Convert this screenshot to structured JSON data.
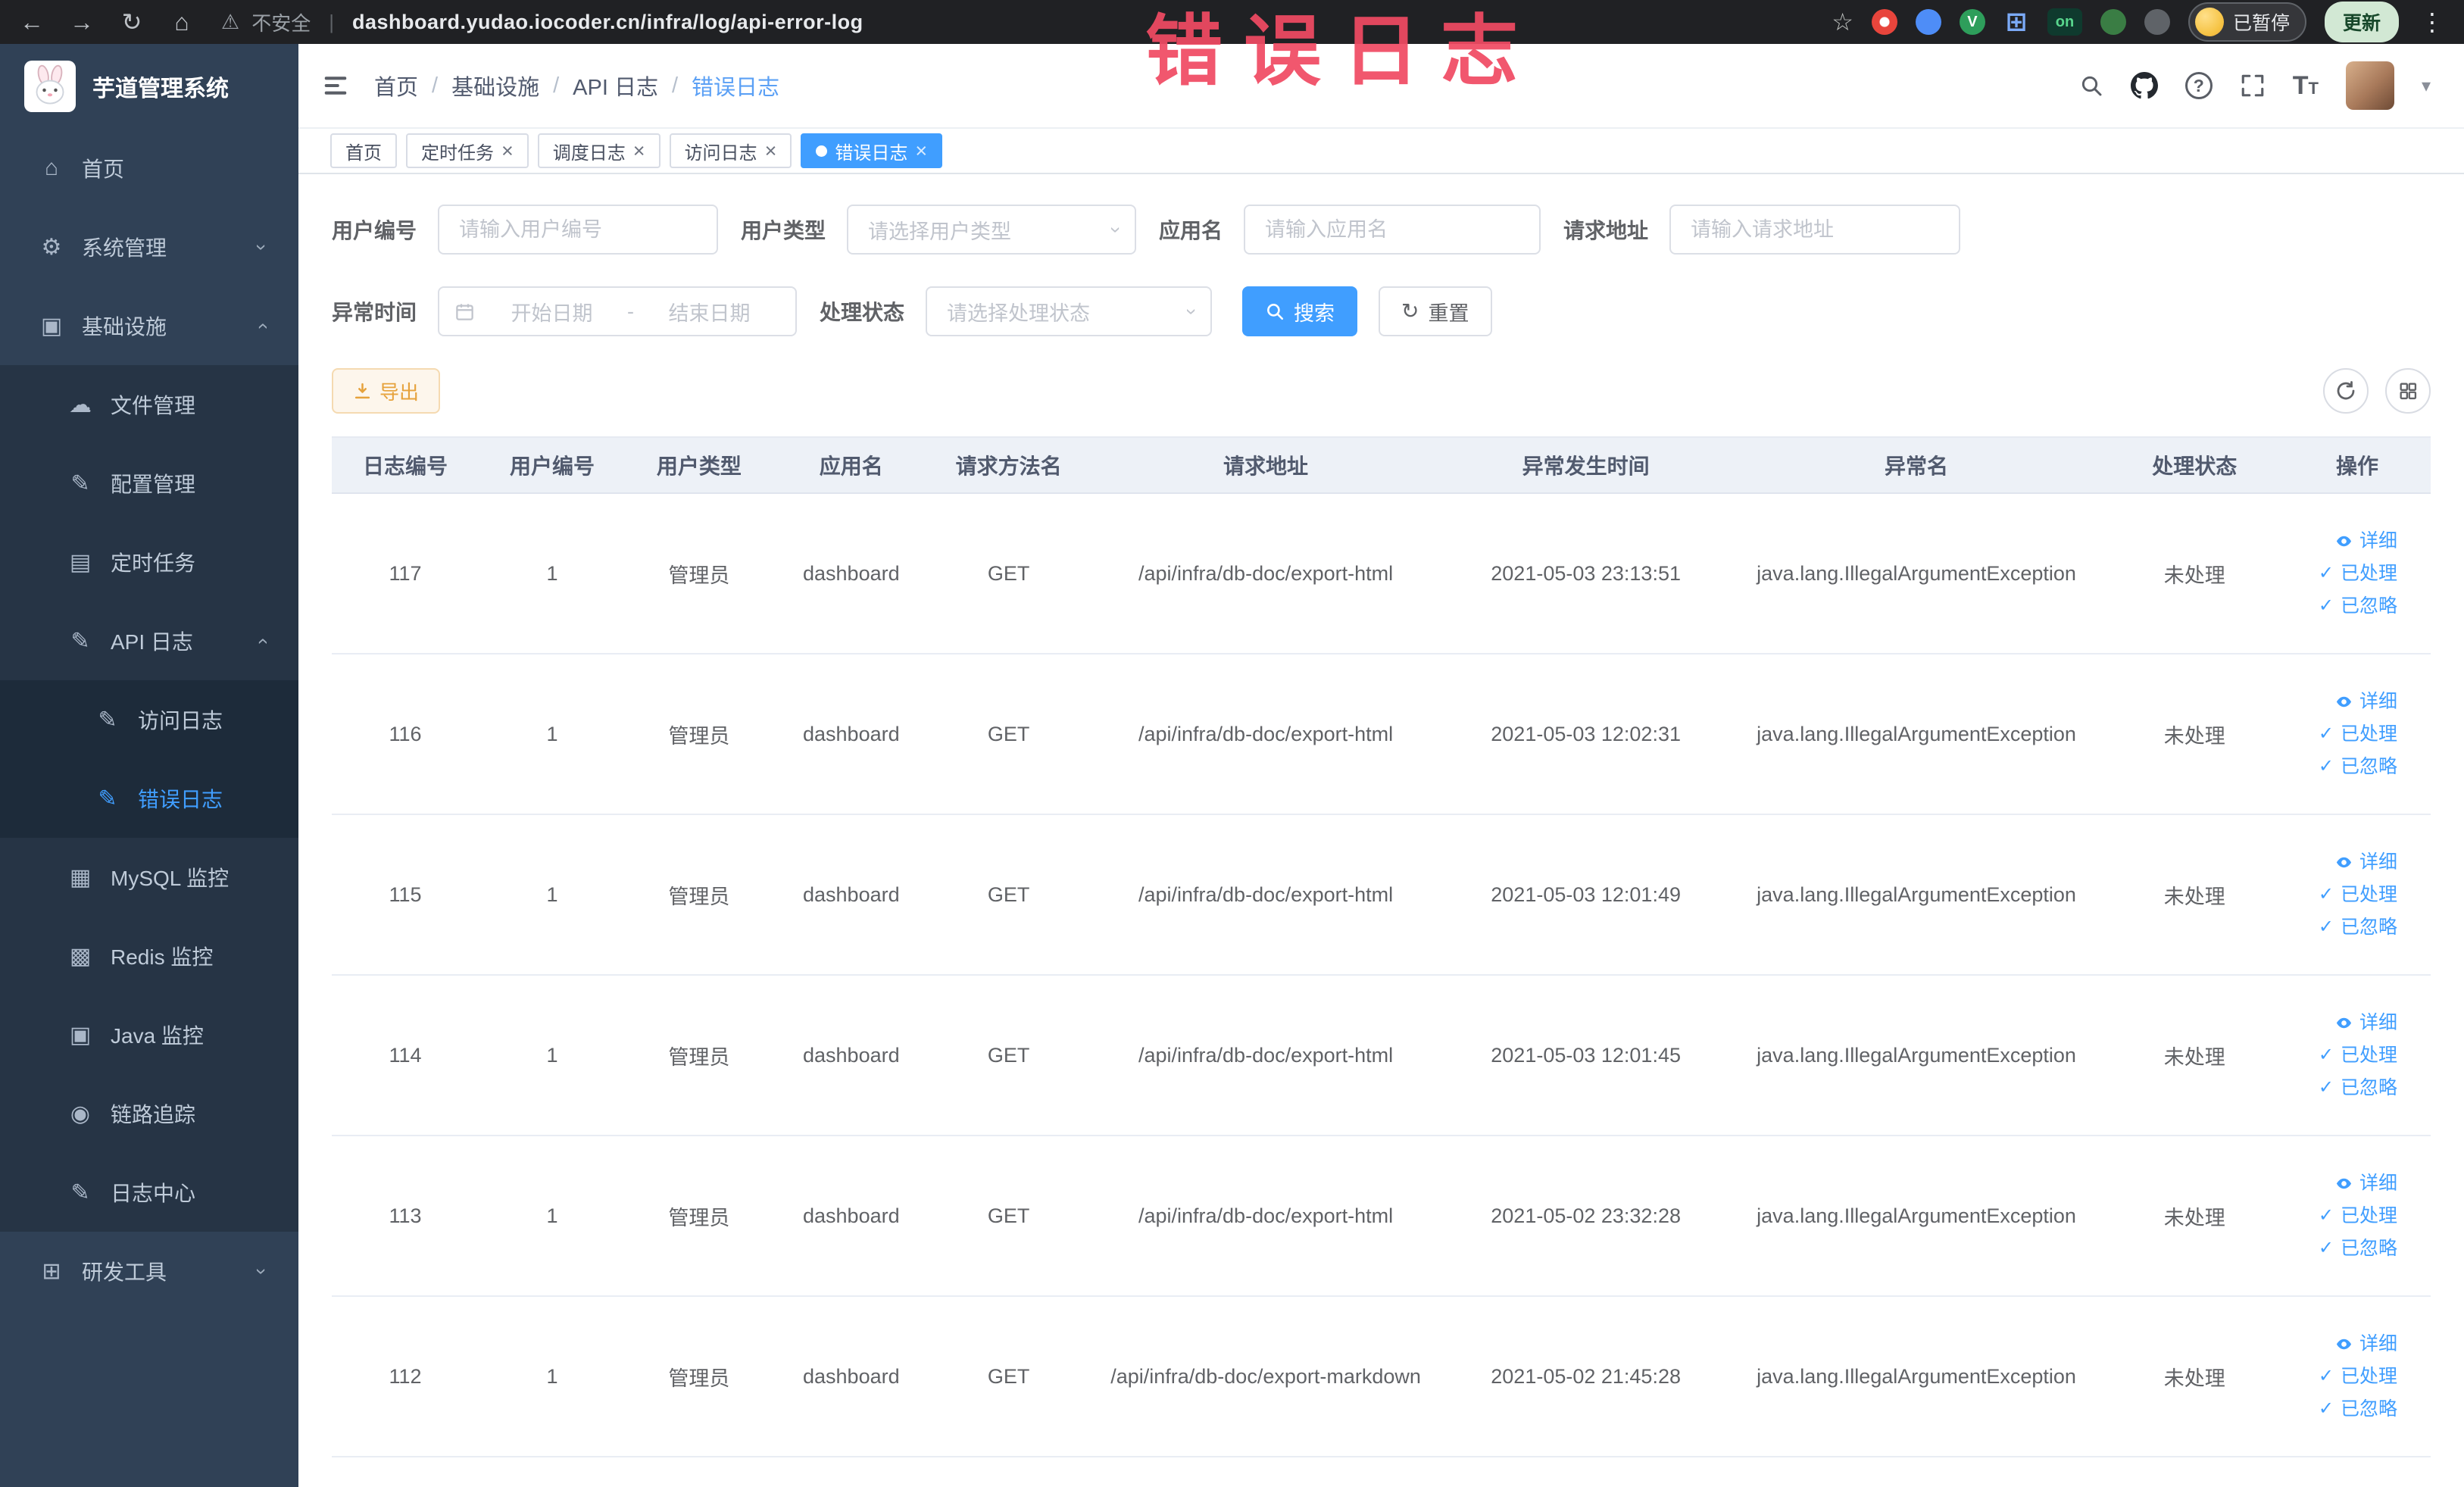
{
  "browser": {
    "security_label": "不安全",
    "url": "dashboard.yudao.iocoder.cn/infra/log/api-error-log",
    "extension_badge": "on",
    "profile_badge": "已暂停",
    "update_button": "更新"
  },
  "annotation": {
    "text": "错误日志"
  },
  "sidebar": {
    "logo_title": "芋道管理系统",
    "items": [
      {
        "key": "home",
        "label": "首页",
        "icon": "home",
        "level": 0
      },
      {
        "key": "system",
        "label": "系统管理",
        "icon": "gear",
        "level": 0,
        "chevron": "down"
      },
      {
        "key": "infra",
        "label": "基础设施",
        "icon": "monitor",
        "level": 0,
        "chevron": "up"
      },
      {
        "key": "file",
        "label": "文件管理",
        "icon": "cloud",
        "level": 1
      },
      {
        "key": "config",
        "label": "配置管理",
        "icon": "edit",
        "level": 1
      },
      {
        "key": "job",
        "label": "定时任务",
        "icon": "list",
        "level": 1
      },
      {
        "key": "api-log",
        "label": "API 日志",
        "icon": "edit",
        "level": 1,
        "chevron": "up"
      },
      {
        "key": "access-log",
        "label": "访问日志",
        "icon": "edit",
        "level": 2
      },
      {
        "key": "error-log",
        "label": "错误日志",
        "icon": "edit",
        "level": 2,
        "active": true
      },
      {
        "key": "mysql",
        "label": "MySQL 监控",
        "icon": "grid",
        "level": 1
      },
      {
        "key": "redis",
        "label": "Redis 监控",
        "icon": "layers",
        "level": 1
      },
      {
        "key": "java",
        "label": "Java 监控",
        "icon": "desktop",
        "level": 1
      },
      {
        "key": "trace",
        "label": "链路追踪",
        "icon": "eye",
        "level": 1
      },
      {
        "key": "log-center",
        "label": "日志中心",
        "icon": "edit",
        "level": 1
      },
      {
        "key": "devtools",
        "label": "研发工具",
        "icon": "toolbox",
        "level": 0,
        "chevron": "down"
      }
    ]
  },
  "header": {
    "breadcrumb": [
      "首页",
      "基础设施",
      "API 日志",
      "错误日志"
    ]
  },
  "tabs": [
    {
      "key": "home",
      "label": "首页",
      "closable": false,
      "active": false
    },
    {
      "key": "job",
      "label": "定时任务",
      "closable": true,
      "active": false
    },
    {
      "key": "job-log",
      "label": "调度日志",
      "closable": true,
      "active": false
    },
    {
      "key": "access-log",
      "label": "访问日志",
      "closable": true,
      "active": false
    },
    {
      "key": "error-log",
      "label": "错误日志",
      "closable": true,
      "active": true
    }
  ],
  "filters": {
    "user_id": {
      "label": "用户编号",
      "placeholder": "请输入用户编号"
    },
    "user_type": {
      "label": "用户类型",
      "placeholder": "请选择用户类型"
    },
    "app_name": {
      "label": "应用名",
      "placeholder": "请输入应用名"
    },
    "request_url": {
      "label": "请求地址",
      "placeholder": "请输入请求地址"
    },
    "exception_time": {
      "label": "异常时间",
      "start_placeholder": "开始日期",
      "separator": "-",
      "end_placeholder": "结束日期"
    },
    "process_status": {
      "label": "处理状态",
      "placeholder": "请选择处理状态"
    },
    "search_button": "搜索",
    "reset_button": "重置"
  },
  "toolbar": {
    "export_button": "导出"
  },
  "table": {
    "columns": [
      "日志编号",
      "用户编号",
      "用户类型",
      "应用名",
      "请求方法名",
      "请求地址",
      "异常发生时间",
      "异常名",
      "处理状态",
      "操作"
    ],
    "row_actions": [
      "详细",
      "已处理",
      "已忽略"
    ],
    "rows": [
      {
        "id": "117",
        "user_id": "1",
        "user_type": "管理员",
        "app_name": "dashboard",
        "method": "GET",
        "url": "/api/infra/db-doc/export-html",
        "time": "2021-05-03 23:13:51",
        "exception": "java.lang.IllegalArgumentException",
        "status": "未处理"
      },
      {
        "id": "116",
        "user_id": "1",
        "user_type": "管理员",
        "app_name": "dashboard",
        "method": "GET",
        "url": "/api/infra/db-doc/export-html",
        "time": "2021-05-03 12:02:31",
        "exception": "java.lang.IllegalArgumentException",
        "status": "未处理"
      },
      {
        "id": "115",
        "user_id": "1",
        "user_type": "管理员",
        "app_name": "dashboard",
        "method": "GET",
        "url": "/api/infra/db-doc/export-html",
        "time": "2021-05-03 12:01:49",
        "exception": "java.lang.IllegalArgumentException",
        "status": "未处理"
      },
      {
        "id": "114",
        "user_id": "1",
        "user_type": "管理员",
        "app_name": "dashboard",
        "method": "GET",
        "url": "/api/infra/db-doc/export-html",
        "time": "2021-05-03 12:01:45",
        "exception": "java.lang.IllegalArgumentException",
        "status": "未处理"
      },
      {
        "id": "113",
        "user_id": "1",
        "user_type": "管理员",
        "app_name": "dashboard",
        "method": "GET",
        "url": "/api/infra/db-doc/export-html",
        "time": "2021-05-02 23:32:28",
        "exception": "java.lang.IllegalArgumentException",
        "status": "未处理"
      },
      {
        "id": "112",
        "user_id": "1",
        "user_type": "管理员",
        "app_name": "dashboard",
        "method": "GET",
        "url": "/api/infra/db-doc/export-markdown",
        "time": "2021-05-02 21:45:28",
        "exception": "java.lang.IllegalArgumentException",
        "status": "未处理"
      }
    ]
  },
  "colors": {
    "accent": "#409eff",
    "warning": "#e6a23c",
    "sidebar_bg": "#304156",
    "annotation": "#f04a63"
  }
}
